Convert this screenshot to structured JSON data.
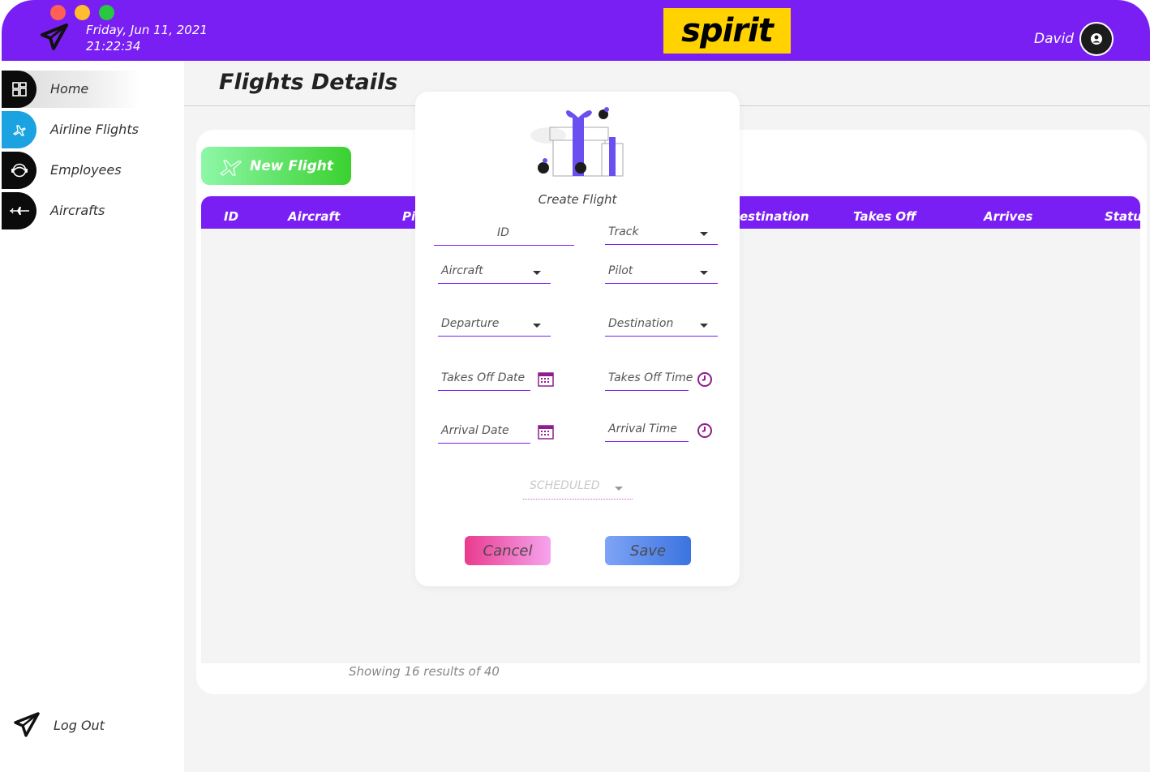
{
  "header": {
    "date": "Friday, Jun 11, 2021",
    "time": "21:22:34",
    "brand": "spirit",
    "user_name": "David",
    "colors": {
      "header_bg": "#7a1ff3",
      "brand_bg": "#ffd200"
    }
  },
  "sidebar": {
    "items": [
      {
        "label": "Home",
        "icon": "dashboard-grid-icon",
        "active": true
      },
      {
        "label": "Airline Flights",
        "icon": "airplane-icon",
        "active": false
      },
      {
        "label": "Employees",
        "icon": "pilot-helmet-icon",
        "active": false
      },
      {
        "label": "Aircrafts",
        "icon": "aircraft-icon",
        "active": false
      }
    ],
    "logout_label": "Log Out"
  },
  "page": {
    "title": "Flights Details",
    "new_flight_label": "New Flight",
    "columns": [
      "ID",
      "Aircraft",
      "Pi",
      "estination",
      "Takes Off",
      "Arrives",
      "Status"
    ],
    "showing": "Showing 16 results of 40"
  },
  "modal": {
    "title": "Create Flight",
    "fields": {
      "id": "ID",
      "track": "Track",
      "aircraft": "Aircraft",
      "pilot": "Pilot",
      "departure": "Departure",
      "destination": "Destination",
      "takes_off_date": "Takes Off Date",
      "takes_off_time": "Takes Off Time",
      "arrival_date": "Arrival Date",
      "arrival_time": "Arrival Time",
      "status": "SCHEDULED"
    },
    "cancel_label": "Cancel",
    "save_label": "Save"
  }
}
